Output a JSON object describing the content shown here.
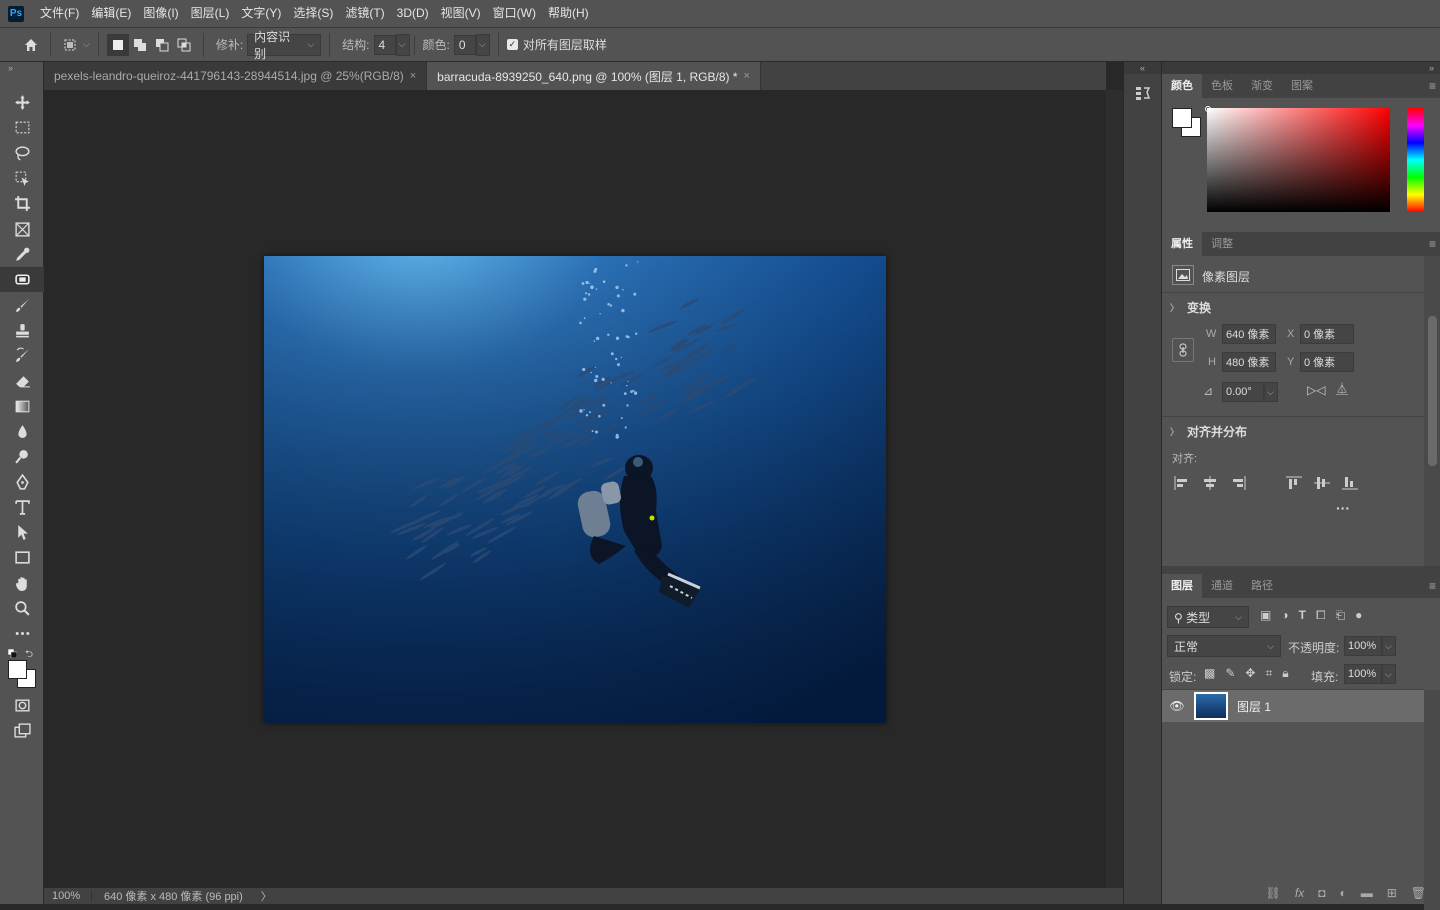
{
  "app": {
    "logo": "Ps"
  },
  "menu": [
    "文件(F)",
    "编辑(E)",
    "图像(I)",
    "图层(L)",
    "文字(Y)",
    "选择(S)",
    "滤镜(T)",
    "3D(D)",
    "视图(V)",
    "窗口(W)",
    "帮助(H)"
  ],
  "options": {
    "repair_label": "修补:",
    "repair_value": "内容识别",
    "structure_label": "结构:",
    "structure_value": "4",
    "color_label": "颜色:",
    "color_value": "0",
    "sample_all_label": "对所有图层取样",
    "sample_all_checked": true
  },
  "tabs": [
    {
      "label": "pexels-leandro-queiroz-441796143-28944514.jpg @ 25%(RGB/8)",
      "active": false
    },
    {
      "label": "barracuda-8939250_640.png @ 100% (图层 1, RGB/8) *",
      "active": true
    }
  ],
  "status": {
    "zoom": "100%",
    "info": "640 像素 x 480 像素 (96 ppi)",
    "arrow": "〉"
  },
  "panel_collapse": {
    "left": "«",
    "right": "»",
    "toolbar": "»"
  },
  "color_panel": {
    "tabs": [
      "颜色",
      "色板",
      "渐变",
      "图案"
    ],
    "foreground": "#ffffff",
    "background": "#ffffff",
    "hue": "#ff0000"
  },
  "properties_panel": {
    "tabs": [
      "属性",
      "调整"
    ],
    "layer_type": "像素图层",
    "transform_title": "变换",
    "w_label": "W",
    "w_value": "640 像素",
    "h_label": "H",
    "h_value": "480 像素",
    "x_label": "X",
    "x_value": "0 像素",
    "y_label": "Y",
    "y_value": "0 像素",
    "angle_value": "0.00°",
    "align_title": "对齐并分布",
    "align_label": "对齐:",
    "more": "···"
  },
  "layers_panel": {
    "tabs": [
      "图层",
      "通道",
      "路径"
    ],
    "filter_kind": "类型",
    "blend_mode": "正常",
    "opacity_label": "不透明度:",
    "opacity_value": "100%",
    "lock_label": "锁定:",
    "fill_label": "填充:",
    "fill_value": "100%",
    "layers": [
      {
        "name": "图层 1",
        "visible": true
      }
    ]
  }
}
